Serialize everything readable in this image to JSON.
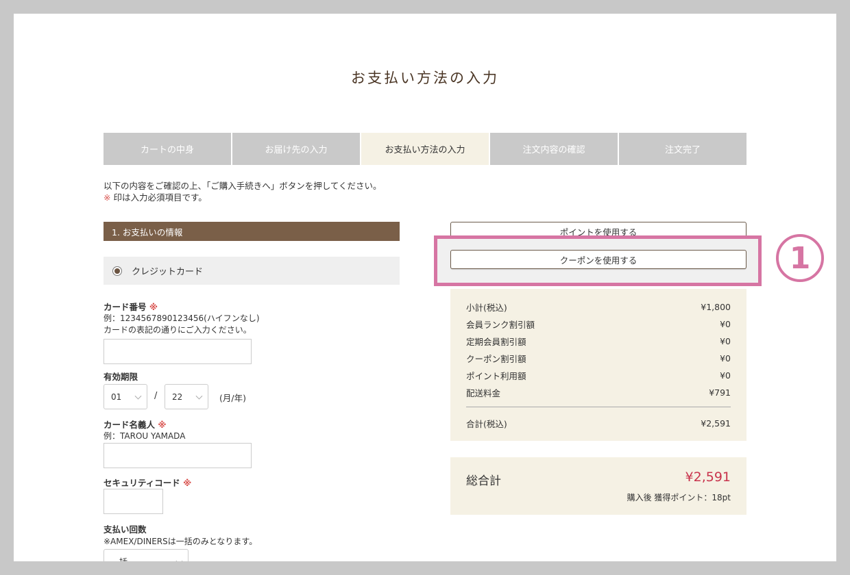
{
  "page_title": "お支払い方法の入力",
  "steps": [
    "カートの中身",
    "お届け先の入力",
    "お支払い方法の入力",
    "注文内容の確認",
    "注文完了"
  ],
  "active_step_index": 2,
  "intro": {
    "line1": "以下の内容をご確認の上、「ご購入手続きへ」ボタンを押してください。",
    "required_mark": "※",
    "line2": "印は入力必須項目です。"
  },
  "payment_section": {
    "header": "1. お支払いの情報",
    "method_label": "クレジットカード",
    "card_number": {
      "label": "カード番号",
      "example": "例：1234567890123456(ハイフンなし)",
      "note": "カードの表記の通りにご入力ください。",
      "value": ""
    },
    "expiry": {
      "label": "有効期限",
      "month": "01",
      "year": "22",
      "separator": "/",
      "suffix": "(月/年)"
    },
    "card_holder": {
      "label": "カード名義人",
      "example": "例：TAROU YAMADA",
      "value": ""
    },
    "security_code": {
      "label": "セキュリティコード",
      "value": ""
    },
    "installments": {
      "label": "支払い回数",
      "note": "※AMEX/DINERSは一括のみとなります。",
      "selected": "一括"
    }
  },
  "right": {
    "use_points_button": "ポイントを使用する",
    "use_coupon_button": "クーポンを使用する",
    "summary_rows": [
      {
        "label": "小計(税込)",
        "value": "¥1,800"
      },
      {
        "label": "会員ランク割引額",
        "value": "¥0"
      },
      {
        "label": "定期会員割引額",
        "value": "¥0"
      },
      {
        "label": "クーポン割引額",
        "value": "¥0"
      },
      {
        "label": "ポイント利用額",
        "value": "¥0"
      },
      {
        "label": "配送料金",
        "value": "¥791"
      }
    ],
    "subtotal_total": {
      "label": "合計(税込)",
      "value": "¥2,591"
    },
    "grand_total": {
      "label": "総合計",
      "value": "¥2,591",
      "points": "購入後 獲得ポイント：18pt"
    }
  },
  "annotation": {
    "number": "1",
    "color": "#d675a3"
  },
  "colors": {
    "section_header": "#7a5f48",
    "price_red": "#c8334c",
    "step_active_bg": "#f5f1e4",
    "step_bg": "#c9c9c9"
  }
}
